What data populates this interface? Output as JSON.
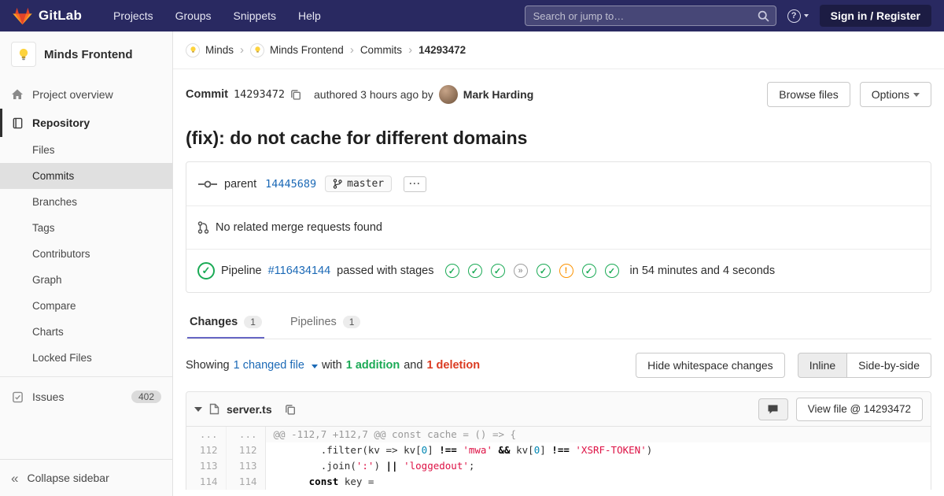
{
  "navbar": {
    "brand": "GitLab",
    "menu": [
      "Projects",
      "Groups",
      "Snippets",
      "Help"
    ],
    "search_placeholder": "Search or jump to…",
    "sign_in_label": "Sign in / Register"
  },
  "sidebar": {
    "project_name": "Minds Frontend",
    "overview_label": "Project overview",
    "repository_label": "Repository",
    "repo_items": [
      "Files",
      "Commits",
      "Branches",
      "Tags",
      "Contributors",
      "Graph",
      "Compare",
      "Charts",
      "Locked Files"
    ],
    "active_repo_item": "Commits",
    "issues_label": "Issues",
    "issues_count": "402",
    "collapse_label": "Collapse sidebar"
  },
  "breadcrumb": {
    "group": "Minds",
    "project": "Minds Frontend",
    "section": "Commits",
    "sha": "14293472"
  },
  "commit": {
    "label": "Commit",
    "sha": "14293472",
    "authored_text": "authored 3 hours ago by",
    "author": "Mark Harding",
    "browse_files_label": "Browse files",
    "options_label": "Options",
    "title": "(fix): do not cache for different domains",
    "parent_label": "parent",
    "parent_sha": "14445689",
    "branch": "master",
    "no_mr_text": "No related merge requests found",
    "pipeline_label": "Pipeline",
    "pipeline_id": "#116434144",
    "pipeline_status": "passed with stages",
    "pipeline_duration": "in 54 minutes and 4 seconds",
    "stages": [
      "passed",
      "passed",
      "passed",
      "skipped",
      "passed",
      "warning",
      "passed",
      "passed"
    ]
  },
  "tabs": {
    "changes_label": "Changes",
    "changes_count": "1",
    "pipelines_label": "Pipelines",
    "pipelines_count": "1"
  },
  "controls": {
    "showing": "Showing",
    "changed_file_link": "1 changed file",
    "with_text": "with",
    "additions": "1 addition",
    "and_text": "and",
    "deletions": "1 deletion",
    "hide_whitespace_label": "Hide whitespace changes",
    "inline_label": "Inline",
    "side_by_side_label": "Side-by-side"
  },
  "diff": {
    "file_name": "server.ts",
    "view_file_label": "View file @ 14293472",
    "lines": [
      {
        "old": "...",
        "new": "...",
        "type": "match",
        "segments": [
          {
            "t": "@@ -112,7 +112,7 @@ const cache = () => {",
            "c": "p"
          }
        ]
      },
      {
        "old": "112",
        "new": "112",
        "type": "context",
        "segments": [
          {
            "t": "        .filter(kv => kv[",
            "c": "p"
          },
          {
            "t": "0",
            "c": "num"
          },
          {
            "t": "] ",
            "c": "p"
          },
          {
            "t": "!==",
            "c": "op"
          },
          {
            "t": " ",
            "c": "p"
          },
          {
            "t": "'mwa'",
            "c": "str"
          },
          {
            "t": " ",
            "c": "p"
          },
          {
            "t": "&&",
            "c": "op"
          },
          {
            "t": " kv[",
            "c": "p"
          },
          {
            "t": "0",
            "c": "num"
          },
          {
            "t": "] ",
            "c": "p"
          },
          {
            "t": "!==",
            "c": "op"
          },
          {
            "t": " ",
            "c": "p"
          },
          {
            "t": "'XSRF-TOKEN'",
            "c": "str"
          },
          {
            "t": ")",
            "c": "p"
          }
        ]
      },
      {
        "old": "113",
        "new": "113",
        "type": "context",
        "segments": [
          {
            "t": "        .join(",
            "c": "p"
          },
          {
            "t": "':'",
            "c": "str"
          },
          {
            "t": ") ",
            "c": "p"
          },
          {
            "t": "||",
            "c": "op"
          },
          {
            "t": " ",
            "c": "p"
          },
          {
            "t": "'loggedout'",
            "c": "str"
          },
          {
            "t": ";",
            "c": "p"
          }
        ]
      },
      {
        "old": "114",
        "new": "114",
        "type": "context",
        "segments": [
          {
            "t": "      ",
            "c": "p"
          },
          {
            "t": "const",
            "c": "kw"
          },
          {
            "t": " key =",
            "c": "p"
          }
        ]
      }
    ]
  },
  "colors": {
    "navbar_bg": "#292961",
    "link_blue": "#1b69b6",
    "addition_green": "#1aaa55",
    "deletion_red": "#db3b21",
    "warning_orange": "#fc9403",
    "tab_indicator": "#6666c4",
    "tanuki_red": "#e24329",
    "tanuki_orange": "#fc6d26",
    "tanuki_yellow": "#fca326"
  }
}
